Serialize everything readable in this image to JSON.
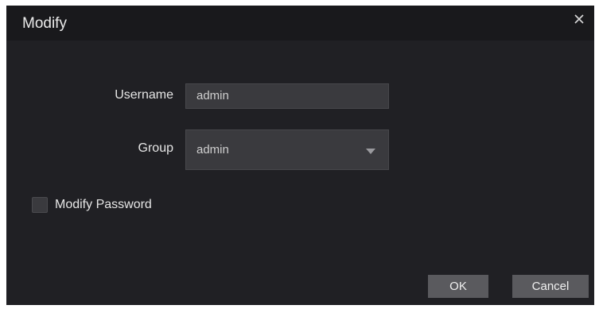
{
  "dialog": {
    "title": "Modify",
    "close_icon": "close-icon"
  },
  "form": {
    "username_label": "Username",
    "username_value": "admin",
    "group_label": "Group",
    "group_value": "admin",
    "modify_password_label": "Modify Password",
    "modify_password_checked": false
  },
  "buttons": {
    "ok_label": "OK",
    "cancel_label": "Cancel"
  },
  "colors": {
    "dialog_background": "#202024",
    "titlebar_background": "#19191c",
    "field_background": "#3a3a3e",
    "button_background": "#5a5a5e"
  }
}
